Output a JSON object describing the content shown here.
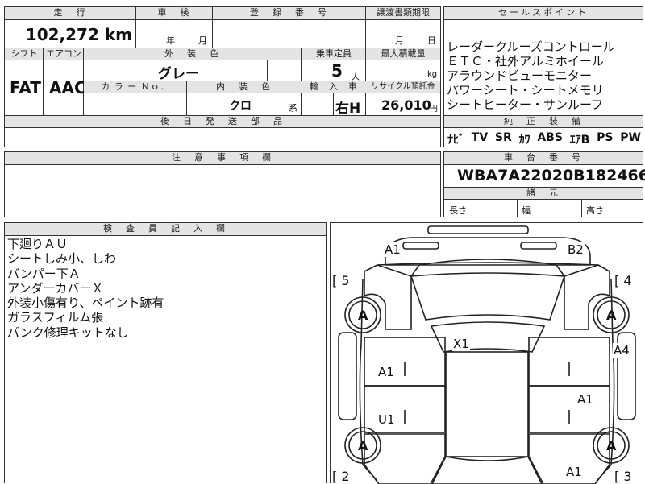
{
  "top_row": {
    "mileage_header": "走　行",
    "mileage_value": "102,272 km",
    "inspection_header": "車　検",
    "inspection_year_unit": "年",
    "inspection_month_unit": "月",
    "registration_header": "登　録　番　号",
    "transfer_header": "譲渡書類期限",
    "transfer_month_unit": "月",
    "transfer_day_unit": "日"
  },
  "second_row": {
    "shift_header": "シフト",
    "shift_value": "FAT",
    "aircon_header": "エアコン",
    "aircon_value": "AAC",
    "exterior_color_header": "外　装　色",
    "exterior_color_value": "グレー",
    "capacity_header": "乗車定員",
    "capacity_value": "5",
    "capacity_unit": "人",
    "max_load_header": "最大積載量",
    "max_load_unit": "kg",
    "color_no_header": "カ ラ ー Ｎｏ．",
    "interior_color_header": "内　装　色",
    "interior_color_value": "クロ",
    "interior_color_suffix": "系",
    "import_header": "輸　入　車",
    "import_value": "右H",
    "recycle_header": "リサイクル預託金",
    "recycle_value": "26,010",
    "recycle_unit": "円"
  },
  "later_parts_header": "後　日　発　送　部　品",
  "sales_points": {
    "header": "セールスポイント",
    "lines": [
      "レーダークルーズコントロール",
      "ＥＴＣ・社外アルミホイール",
      "アラウンドビューモニター",
      "パワーシート・シートメモリ",
      "シートヒーター・サンルーフ"
    ]
  },
  "equipment": {
    "header": "純　正　装　備",
    "items": [
      "ﾅﾋﾞ",
      "TV",
      "SR",
      "ｶﾜ",
      "ABS",
      "ｴｱB",
      "PS",
      "PW"
    ]
  },
  "caution_header": "注　意　事　項　欄",
  "chassis": {
    "header": "車　台　番　号",
    "value": "WBA7A22020B182466"
  },
  "dimensions": {
    "header": "諸　元",
    "length": "長さ",
    "width": "幅",
    "height": "高さ"
  },
  "inspector": {
    "header": "検　査　員　記　入　欄",
    "lines": [
      "下廻りＡＵ",
      "シートしみ小、しわ",
      "バンパー下Ａ",
      "アンダーカバーＸ",
      "外装小傷有り、ペイント跡有",
      "ガラスフィルム張",
      "パンク修理キットなし"
    ]
  },
  "diagram": {
    "tire_mark": "A",
    "labels": {
      "front_left_bumper": "A1",
      "front_right_bumper": "B2",
      "roof": "X1",
      "left_front_door": "A1",
      "left_rear_door": "U1",
      "right_front_fender": "A4",
      "right_rear_door": "A1",
      "right_rear_quarter": "A1"
    },
    "corner_marks": {
      "front_left": "[ 5",
      "front_right": "[ 4",
      "rear_left": "[ 2",
      "rear_right": "[ 3"
    }
  }
}
